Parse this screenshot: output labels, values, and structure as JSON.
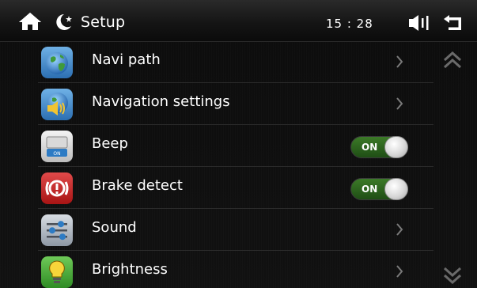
{
  "header": {
    "title": "Setup",
    "time": "15 : 28",
    "icons": [
      "home-icon",
      "night-mode-icon",
      "volume-icon",
      "back-icon"
    ]
  },
  "menu": {
    "items": [
      {
        "label": "Navi path",
        "icon": "globe-icon",
        "control": "chevron"
      },
      {
        "label": "Navigation settings",
        "icon": "navigation-speaker-icon",
        "control": "chevron"
      },
      {
        "label": "Beep",
        "icon": "beep-icon",
        "control": "toggle",
        "toggle_text": "ON",
        "state": true
      },
      {
        "label": "Brake detect",
        "icon": "brake-icon",
        "control": "toggle",
        "toggle_text": "ON",
        "state": true
      },
      {
        "label": "Sound",
        "icon": "equalizer-icon",
        "control": "chevron"
      },
      {
        "label": "Brightness",
        "icon": "bulb-icon",
        "control": "chevron"
      }
    ]
  },
  "scroll": {
    "icons": [
      "scroll-up-icon",
      "scroll-down-icon"
    ]
  },
  "colors": {
    "toggle_on": "#2f6a1f",
    "background": "#0e0e0e",
    "divider": "#2b2b2b",
    "text": "#ffffff"
  }
}
